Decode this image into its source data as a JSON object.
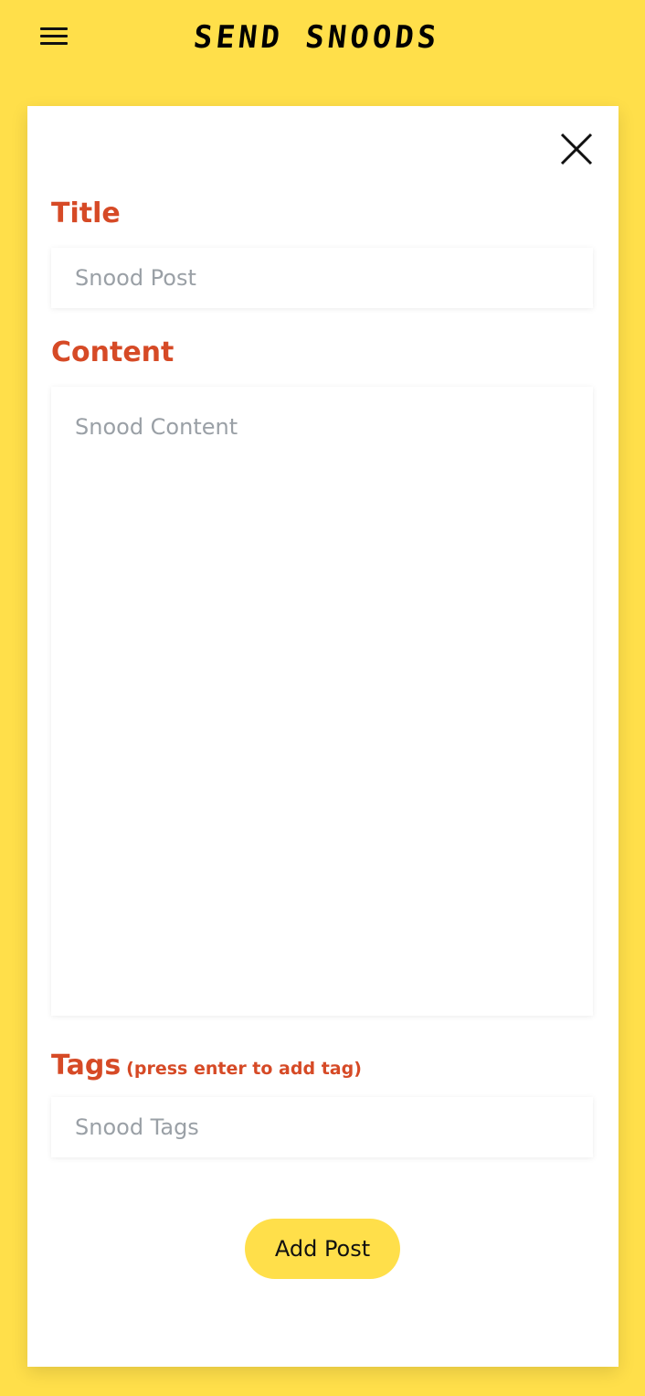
{
  "header": {
    "logo_text": "SEND SNOODS"
  },
  "form": {
    "title_label": "Title",
    "title_placeholder": "Snood Post",
    "content_label": "Content",
    "content_placeholder": "Snood Content",
    "tags_label": "Tags",
    "tags_hint": "(press enter to add tag)",
    "tags_placeholder": "Snood Tags",
    "submit_label": "Add Post"
  },
  "colors": {
    "background": "#FFDF4A",
    "label": "#D64A26",
    "button": "#FFDF4A"
  },
  "icons": {
    "menu": "hamburger-menu-icon",
    "close": "close-icon"
  }
}
